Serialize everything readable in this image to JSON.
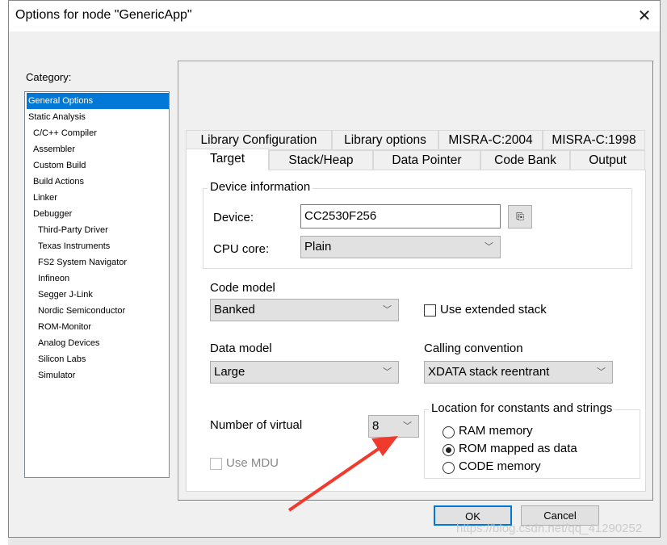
{
  "window": {
    "title": "Options for node \"GenericApp\"",
    "close": "✕"
  },
  "category": {
    "label": "Category:",
    "items": [
      "General Options",
      "Static Analysis",
      "C/C++ Compiler",
      "Assembler",
      "Custom Build",
      "Build Actions",
      "Linker",
      "Debugger",
      "Third-Party Driver",
      "Texas Instruments",
      "FS2 System Navigator",
      "Infineon",
      "Segger J-Link",
      "Nordic Semiconductor",
      "ROM-Monitor",
      "Analog Devices",
      "Silicon Labs",
      "Simulator"
    ],
    "selected": "General Options"
  },
  "tabs": {
    "row1": [
      "Library Configuration",
      "Library options",
      "MISRA-C:2004",
      "MISRA-C:1998"
    ],
    "row2": [
      "Target",
      "Stack/Heap",
      "Data Pointer",
      "Code Bank",
      "Output"
    ],
    "active": "Target"
  },
  "device_info": {
    "title": "Device information",
    "device_label": "Device:",
    "device_value": "CC2530F256",
    "cpu_label": "CPU core:",
    "cpu_value": "Plain"
  },
  "code_model": {
    "label": "Code model",
    "value": "Banked"
  },
  "extended_stack": {
    "label": "Use extended stack",
    "checked": false
  },
  "data_model": {
    "label": "Data model",
    "value": "Large"
  },
  "calling_convention": {
    "label": "Calling convention",
    "value": "XDATA stack reentrant"
  },
  "virtual": {
    "label": "Number of virtual",
    "value": "8"
  },
  "mdu": {
    "label": "Use MDU",
    "checked": false,
    "disabled": true
  },
  "location": {
    "title": "Location for constants and strings",
    "options": [
      "RAM memory",
      "ROM mapped as data",
      "CODE memory"
    ],
    "selected": "ROM mapped as data"
  },
  "buttons": {
    "ok": "OK",
    "cancel": "Cancel"
  },
  "watermark": "https://blog.csdn.net/qq_41290252",
  "colors": {
    "selection": "#0078d7",
    "annotation_arrow": "#f03a2e"
  }
}
